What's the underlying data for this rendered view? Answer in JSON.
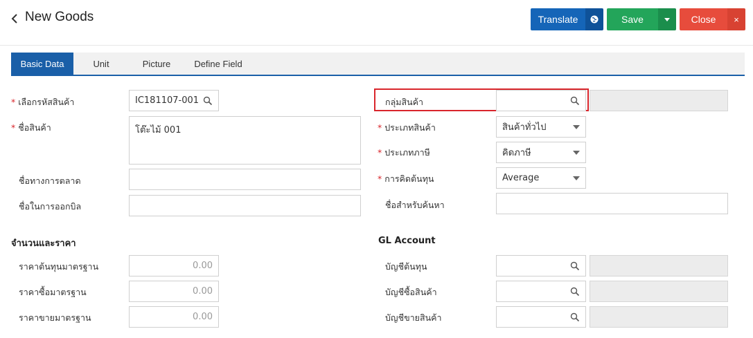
{
  "header": {
    "title": "New Goods",
    "translate_label": "Translate",
    "save_label": "Save",
    "close_label": "Close",
    "close_x": "×"
  },
  "tabs": [
    {
      "label": "Basic Data",
      "active": true
    },
    {
      "label": "Unit",
      "active": false
    },
    {
      "label": "Picture",
      "active": false
    },
    {
      "label": "Define Field",
      "active": false
    }
  ],
  "form": {
    "goods_code": {
      "label": "เลือกรหัสสินค้า",
      "value": "IC181107-001",
      "required": true
    },
    "goods_name": {
      "label": "ชื่อสินค้า",
      "value": "โต๊ะไม้ 001",
      "required": true
    },
    "marketing_name": {
      "label": "ชื่อทางการตลาด",
      "value": ""
    },
    "billing_name": {
      "label": "ชื่อในการออกบิล",
      "value": ""
    },
    "goods_group": {
      "label": "กลุ่มสินค้า",
      "value": "",
      "desc": ""
    },
    "goods_type": {
      "label": "ประเภทสินค้า",
      "value": "สินค้าทั่วไป",
      "required": true
    },
    "tax_type": {
      "label": "ประเภทภาษี",
      "value": "คิดภาษี",
      "required": true
    },
    "costing": {
      "label": "การคิดต้นทุน",
      "value": "Average",
      "required": true
    },
    "search_name": {
      "label": "ชื่อสำหรับค้นหา",
      "value": ""
    }
  },
  "pricing": {
    "title": "จำนวนและราคา",
    "std_cost": {
      "label": "ราคาต้นทุนมาตรฐาน",
      "value": "0.00"
    },
    "std_buy": {
      "label": "ราคาซื้อมาตรฐาน",
      "value": "0.00"
    },
    "std_sell": {
      "label": "ราคาขายมาตรฐาน",
      "value": "0.00"
    }
  },
  "gl": {
    "title": "GL Account",
    "cost_account": {
      "label": "บัญชีต้นทุน",
      "value": "",
      "desc": ""
    },
    "purchase_account": {
      "label": "บัญชีซื้อสินค้า",
      "value": "",
      "desc": ""
    },
    "sales_account": {
      "label": "บัญชีขายสินค้า",
      "value": "",
      "desc": ""
    }
  },
  "colors": {
    "primary": "#1565b8",
    "save": "#23a55a",
    "close": "#e74c3c",
    "required": "#d9252b"
  },
  "icons": [
    "chevron-left-icon",
    "globe-icon",
    "caret-down-icon",
    "close-icon",
    "search-icon"
  ]
}
